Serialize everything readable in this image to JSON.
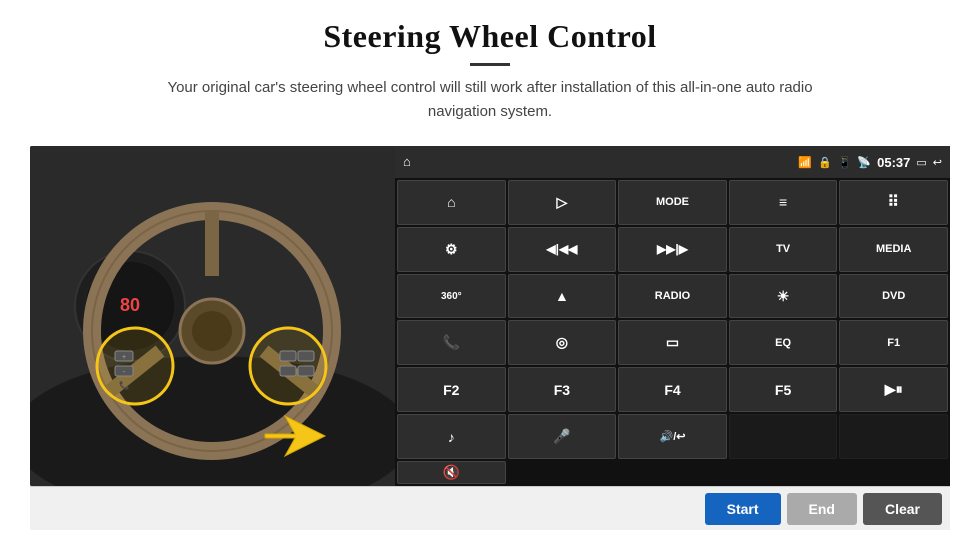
{
  "header": {
    "title": "Steering Wheel Control",
    "subtitle": "Your original car's steering wheel control will still work after installation of this all-in-one auto radio navigation system."
  },
  "status_bar": {
    "time": "05:37",
    "icons": [
      "wifi",
      "lock",
      "sim",
      "bluetooth",
      "battery",
      "window",
      "back"
    ]
  },
  "grid_buttons": [
    {
      "id": "r1c1",
      "label": "⌂",
      "type": "icon"
    },
    {
      "id": "r1c2",
      "label": "▷",
      "type": "icon"
    },
    {
      "id": "r1c3",
      "label": "MODE",
      "type": "text"
    },
    {
      "id": "r1c4",
      "label": "≡",
      "type": "icon"
    },
    {
      "id": "r1c5",
      "label": "🔇",
      "type": "icon"
    },
    {
      "id": "r1c6",
      "label": "⠿",
      "type": "icon"
    },
    {
      "id": "r2c1",
      "label": "⚙",
      "type": "icon"
    },
    {
      "id": "r2c2",
      "label": "◀|◀◀",
      "type": "icon"
    },
    {
      "id": "r2c3",
      "label": "▶▶|▶",
      "type": "icon"
    },
    {
      "id": "r2c4",
      "label": "TV",
      "type": "text"
    },
    {
      "id": "r2c5",
      "label": "MEDIA",
      "type": "text"
    },
    {
      "id": "r3c1",
      "label": "360°",
      "type": "icon"
    },
    {
      "id": "r3c2",
      "label": "▲",
      "type": "icon"
    },
    {
      "id": "r3c3",
      "label": "RADIO",
      "type": "text"
    },
    {
      "id": "r3c4",
      "label": "☀",
      "type": "icon"
    },
    {
      "id": "r3c5",
      "label": "DVD",
      "type": "text"
    },
    {
      "id": "r4c1",
      "label": "📞",
      "type": "icon"
    },
    {
      "id": "r4c2",
      "label": "◎",
      "type": "icon"
    },
    {
      "id": "r4c3",
      "label": "▭",
      "type": "icon"
    },
    {
      "id": "r4c4",
      "label": "EQ",
      "type": "text"
    },
    {
      "id": "r4c5",
      "label": "F1",
      "type": "text"
    },
    {
      "id": "r5c1",
      "label": "F2",
      "type": "text"
    },
    {
      "id": "r5c2",
      "label": "F3",
      "type": "text"
    },
    {
      "id": "r5c3",
      "label": "F4",
      "type": "text"
    },
    {
      "id": "r5c4",
      "label": "F5",
      "type": "text"
    },
    {
      "id": "r5c5",
      "label": "▶⏸",
      "type": "icon"
    },
    {
      "id": "r6c1",
      "label": "♪",
      "type": "icon"
    },
    {
      "id": "r6c2",
      "label": "🎤",
      "type": "icon"
    },
    {
      "id": "r6c3",
      "label": "🔊/↩",
      "type": "icon"
    },
    {
      "id": "r6c4",
      "label": "",
      "type": "empty"
    },
    {
      "id": "r6c5",
      "label": "",
      "type": "empty"
    }
  ],
  "action_buttons": {
    "start": "Start",
    "end": "End",
    "clear": "Clear"
  }
}
